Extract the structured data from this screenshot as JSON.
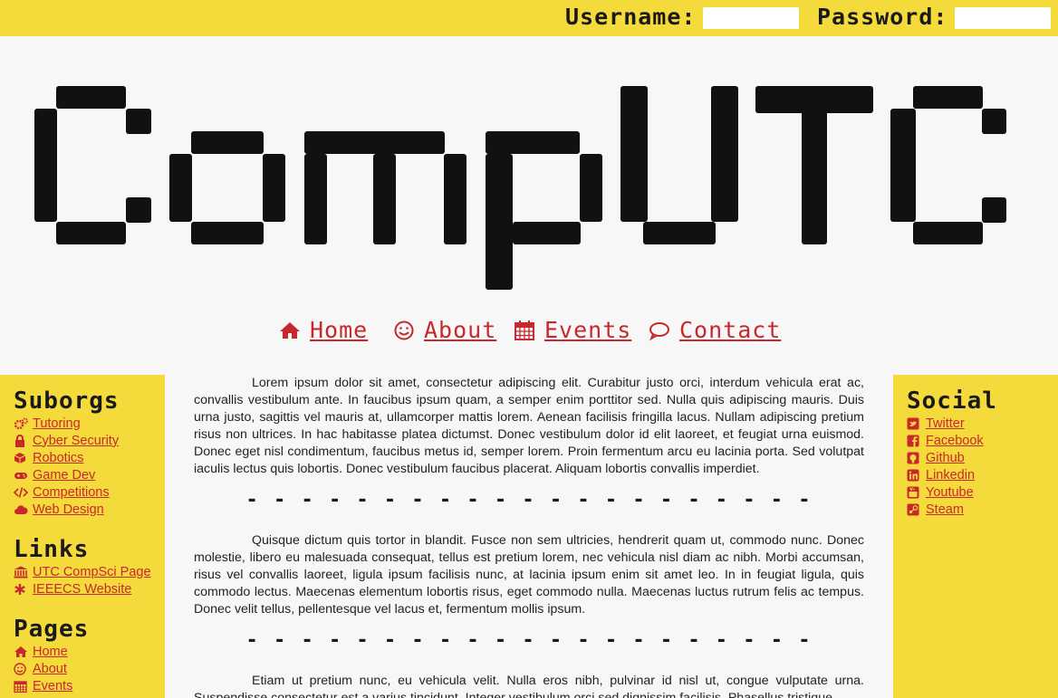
{
  "login": {
    "username_label": "Username:",
    "password_label": "Password:",
    "username_value": "",
    "password_value": ""
  },
  "logo": {
    "text": "CompUTC"
  },
  "nav": [
    {
      "label": "Home",
      "icon": "home-icon"
    },
    {
      "label": "About",
      "icon": "smile-icon"
    },
    {
      "label": "Events",
      "icon": "calendar-icon"
    },
    {
      "label": "Contact",
      "icon": "chat-bubble-icon"
    }
  ],
  "left_sidebar": {
    "suborgs_title": "Suborgs",
    "suborgs": [
      {
        "label": "Tutoring",
        "icon": "gears-icon"
      },
      {
        "label": "Cyber Security",
        "icon": "lock-icon"
      },
      {
        "label": "Robotics",
        "icon": "cube-icon"
      },
      {
        "label": "Game Dev",
        "icon": "gamepad-icon"
      },
      {
        "label": "Competitions",
        "icon": "code-icon"
      },
      {
        "label": "Web Design",
        "icon": "cloud-icon"
      }
    ],
    "links_title": "Links",
    "links": [
      {
        "label": "UTC CompSci Page",
        "icon": "university-icon"
      },
      {
        "label": "IEEECS Website",
        "icon": "asterisk-icon"
      }
    ],
    "pages_title": "Pages",
    "pages": [
      {
        "label": "Home",
        "icon": "home-icon"
      },
      {
        "label": "About",
        "icon": "smile-icon"
      },
      {
        "label": "Events",
        "icon": "calendar-icon"
      }
    ]
  },
  "right_sidebar": {
    "social_title": "Social",
    "social": [
      {
        "label": "Twitter",
        "icon": "twitter-icon"
      },
      {
        "label": "Facebook",
        "icon": "facebook-icon"
      },
      {
        "label": "Github",
        "icon": "github-icon"
      },
      {
        "label": "Linkedin",
        "icon": "linkedin-icon"
      },
      {
        "label": "Youtube",
        "icon": "youtube-icon"
      },
      {
        "label": "Steam",
        "icon": "steam-icon"
      }
    ]
  },
  "content": {
    "paragraphs": [
      "Lorem ipsum dolor sit amet, consectetur adipiscing elit. Curabitur justo orci, interdum vehicula erat ac, convallis vestibulum ante. In faucibus ipsum quam, a semper enim porttitor sed. Nulla quis adipiscing mauris. Duis urna justo, sagittis vel mauris at, ullamcorper mattis lorem. Aenean facilisis fringilla lacus. Nullam adipiscing pretium risus non ultrices. In hac habitasse platea dictumst. Donec vestibulum dolor id elit laoreet, et feugiat urna euismod. Donec eget nisl condimentum, faucibus metus id, semper lorem. Proin fermentum arcu eu lacinia porta. Sed volutpat iaculis lectus quis lobortis. Donec vestibulum faucibus placerat. Aliquam lobortis convallis imperdiet.",
      "Quisque dictum quis tortor in blandit. Fusce non sem ultricies, hendrerit quam ut, commodo nunc. Donec molestie, libero eu malesuada consequat, tellus est pretium lorem, nec vehicula nisl diam ac nibh. Morbi accumsan, risus vel convallis laoreet, ligula ipsum facilisis nunc, at lacinia ipsum enim sit amet leo. In in feugiat ligula, quis commodo lectus. Maecenas elementum lobortis risus, eget commodo nulla. Maecenas luctus rutrum felis ac tempus. Donec velit tellus, pellentesque vel lacus et, fermentum mollis ipsum.",
      "Etiam ut pretium nunc, eu vehicula velit. Nulla eros nibh, pulvinar id nisl ut, congue vulputate urna. Suspendisse consectetur est a varius tincidunt. Integer vestibulum orci sed dignissim facilisis. Phasellus tristique"
    ],
    "divider": "- - - - - - - - - - - - - - - - - - - - -"
  },
  "colors": {
    "accent_yellow": "#f5da3c",
    "link_red": "#c8282d",
    "logo_black": "#111111",
    "background": "#f7f7f7"
  }
}
